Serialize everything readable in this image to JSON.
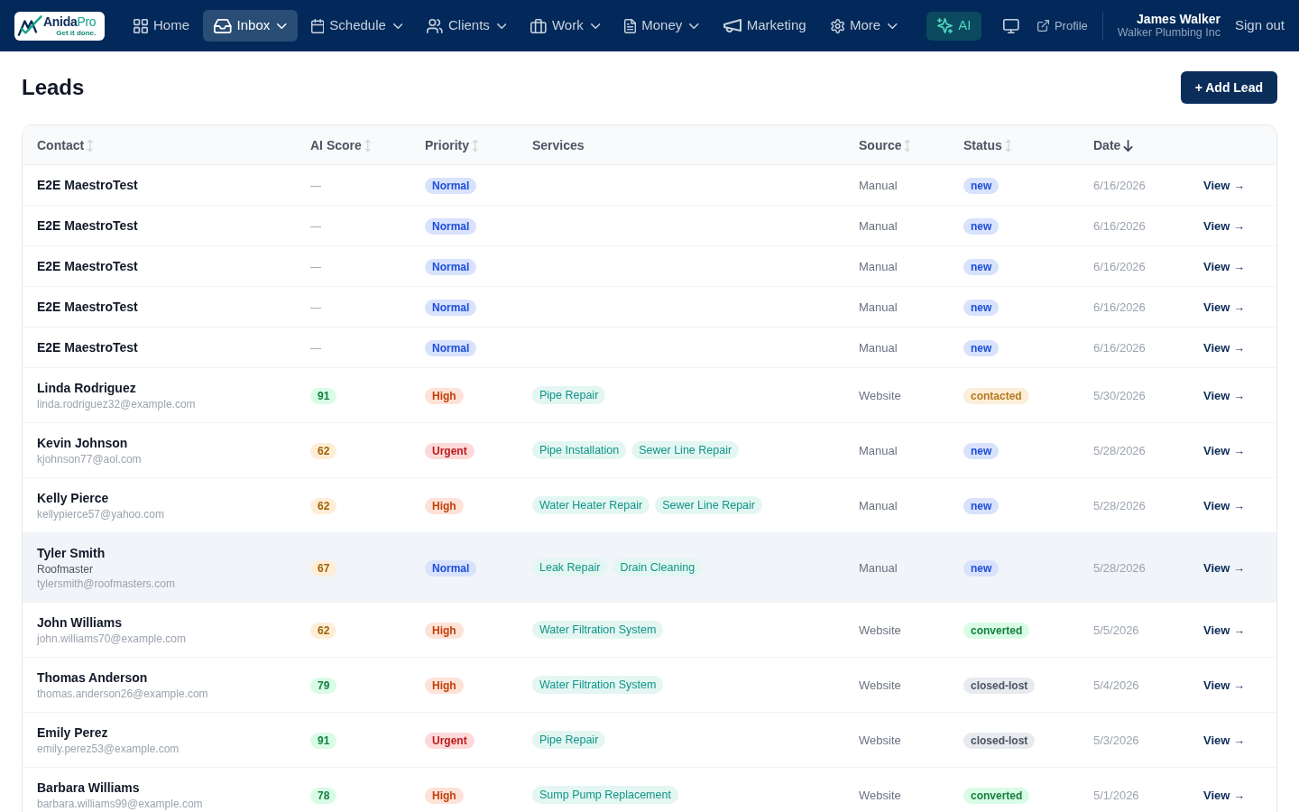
{
  "navbar": {
    "logo": {
      "wordmark": "Anida",
      "wordmark_accent": "Pro",
      "tagline": "Get it done."
    },
    "items": [
      {
        "label": "Home",
        "dropdown": false,
        "selected": false
      },
      {
        "label": "Inbox",
        "dropdown": true,
        "selected": true
      },
      {
        "label": "Schedule",
        "dropdown": true,
        "selected": false
      },
      {
        "label": "Clients",
        "dropdown": true,
        "selected": false
      },
      {
        "label": "Work",
        "dropdown": true,
        "selected": false
      },
      {
        "label": "Money",
        "dropdown": true,
        "selected": false
      },
      {
        "label": "Marketing",
        "dropdown": false,
        "selected": false
      },
      {
        "label": "More",
        "dropdown": true,
        "selected": false
      }
    ],
    "ai_button": {
      "label": "AI"
    },
    "profile_link": {
      "label": "Profile"
    },
    "user": {
      "name": "James Walker",
      "company": "Walker Plumbing Inc"
    },
    "sign_out": "Sign out"
  },
  "page": {
    "title": "Leads",
    "add_button": "+ Add Lead"
  },
  "table": {
    "columns": [
      {
        "label": "Contact",
        "sortable": true,
        "sorted": false
      },
      {
        "label": "AI Score",
        "sortable": true,
        "sorted": false
      },
      {
        "label": "Priority",
        "sortable": true,
        "sorted": false
      },
      {
        "label": "Services",
        "sortable": false,
        "sorted": false
      },
      {
        "label": "Source",
        "sortable": true,
        "sorted": false
      },
      {
        "label": "Status",
        "sortable": true,
        "sorted": false
      },
      {
        "label": "Date",
        "sortable": true,
        "sorted": true
      }
    ],
    "rows": [
      {
        "name": "E2E MaestroTest",
        "ai_score": {
          "kind": "dash",
          "text": "—"
        },
        "priority": {
          "label": "Normal",
          "color": "#1d4ed8"
        },
        "source": "Manual",
        "status": {
          "label": "new",
          "color": "#1d4ed8"
        },
        "date": "6/16/2026",
        "action": "View →",
        "hovered": false
      },
      {
        "name": "E2E MaestroTest",
        "ai_score": {
          "kind": "dash",
          "text": "—"
        },
        "priority": {
          "label": "Normal",
          "color": "#1d4ed8"
        },
        "source": "Manual",
        "status": {
          "label": "new",
          "color": "#1d4ed8"
        },
        "date": "6/16/2026",
        "action": "View →",
        "hovered": false
      },
      {
        "name": "E2E MaestroTest",
        "ai_score": {
          "kind": "dash",
          "text": "—"
        },
        "priority": {
          "label": "Normal",
          "color": "#1d4ed8"
        },
        "source": "Manual",
        "status": {
          "label": "new",
          "color": "#1d4ed8"
        },
        "date": "6/16/2026",
        "action": "View →",
        "hovered": false
      },
      {
        "name": "E2E MaestroTest",
        "ai_score": {
          "kind": "dash",
          "text": "—"
        },
        "priority": {
          "label": "Normal",
          "color": "#1d4ed8"
        },
        "source": "Manual",
        "status": {
          "label": "new",
          "color": "#1d4ed8"
        },
        "date": "6/16/2026",
        "action": "View →",
        "hovered": false
      },
      {
        "name": "E2E MaestroTest",
        "ai_score": {
          "kind": "dash",
          "text": "—"
        },
        "priority": {
          "label": "Normal",
          "color": "#1d4ed8"
        },
        "source": "Manual",
        "status": {
          "label": "new",
          "color": "#1d4ed8"
        },
        "date": "6/16/2026",
        "action": "View →",
        "hovered": false
      },
      {
        "name": "Linda Rodriguez",
        "email": "linda.rodriguez32@example.com",
        "ai_score": {
          "kind": "badge",
          "text": "91",
          "color": "#15803d"
        },
        "priority": {
          "label": "High",
          "color": "#c2410c"
        },
        "services": [
          "Pipe Repair"
        ],
        "source": "Website",
        "status": {
          "label": "contacted",
          "color": "#b7791f"
        },
        "date": "5/30/2026",
        "action": "View →",
        "hovered": false
      },
      {
        "name": "Kevin Johnson",
        "email": "kjohnson77@aol.com",
        "ai_score": {
          "kind": "badge",
          "text": "62",
          "color": "#a16207"
        },
        "priority": {
          "label": "Urgent",
          "color": "#b91c1c"
        },
        "services": [
          "Pipe Installation",
          "Sewer Line Repair"
        ],
        "source": "Manual",
        "status": {
          "label": "new",
          "color": "#1d4ed8"
        },
        "date": "5/28/2026",
        "action": "View →",
        "hovered": false
      },
      {
        "name": "Kelly Pierce",
        "email": "kellypierce57@yahoo.com",
        "ai_score": {
          "kind": "badge",
          "text": "62",
          "color": "#a16207"
        },
        "priority": {
          "label": "High",
          "color": "#c2410c"
        },
        "services": [
          "Water Heater Repair",
          "Sewer Line Repair"
        ],
        "source": "Manual",
        "status": {
          "label": "new",
          "color": "#1d4ed8"
        },
        "date": "5/28/2026",
        "action": "View →",
        "hovered": false
      },
      {
        "name": "Tyler Smith",
        "company": "Roofmaster",
        "email": "tylersmith@roofmasters.com",
        "ai_score": {
          "kind": "badge",
          "text": "67",
          "color": "#a16207"
        },
        "priority": {
          "label": "Normal",
          "color": "#1d4ed8"
        },
        "services": [
          "Leak Repair",
          "Drain Cleaning"
        ],
        "source": "Manual",
        "status": {
          "label": "new",
          "color": "#1d4ed8"
        },
        "date": "5/28/2026",
        "action": "View →",
        "hovered": true
      },
      {
        "name": "John Williams",
        "email": "john.williams70@example.com",
        "ai_score": {
          "kind": "badge",
          "text": "62",
          "color": "#a16207"
        },
        "priority": {
          "label": "High",
          "color": "#c2410c"
        },
        "services": [
          "Water Filtration System"
        ],
        "source": "Website",
        "status": {
          "label": "converted",
          "color": "#15803d"
        },
        "date": "5/5/2026",
        "action": "View →",
        "hovered": false
      },
      {
        "name": "Thomas Anderson",
        "email": "thomas.anderson26@example.com",
        "ai_score": {
          "kind": "badge",
          "text": "79",
          "color": "#15803d"
        },
        "priority": {
          "label": "High",
          "color": "#c2410c"
        },
        "services": [
          "Water Filtration System"
        ],
        "source": "Website",
        "status": {
          "label": "closed-lost",
          "color": "#4b5563"
        },
        "date": "5/4/2026",
        "action": "View →",
        "hovered": false
      },
      {
        "name": "Emily Perez",
        "email": "emily.perez53@example.com",
        "ai_score": {
          "kind": "badge",
          "text": "91",
          "color": "#15803d"
        },
        "priority": {
          "label": "Urgent",
          "color": "#b91c1c"
        },
        "services": [
          "Pipe Repair"
        ],
        "source": "Website",
        "status": {
          "label": "closed-lost",
          "color": "#4b5563"
        },
        "date": "5/3/2026",
        "action": "View →",
        "hovered": false
      },
      {
        "name": "Barbara Williams",
        "email": "barbara.williams99@example.com",
        "ai_score": {
          "kind": "badge",
          "text": "78",
          "color": "#15803d"
        },
        "priority": {
          "label": "High",
          "color": "#c2410c"
        },
        "services": [
          "Sump Pump Replacement"
        ],
        "source": "Website",
        "status": {
          "label": "converted",
          "color": "#15803d"
        },
        "date": "5/1/2026",
        "action": "View →",
        "hovered": false
      }
    ]
  }
}
